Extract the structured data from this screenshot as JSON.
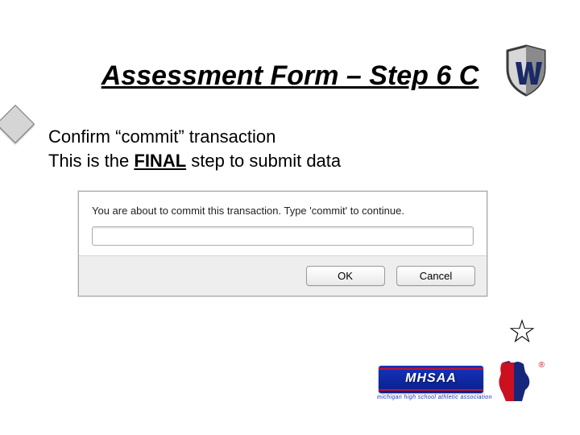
{
  "heading": "Assessment Form – Step 6 C",
  "body": {
    "line1": "Confirm “commit” transaction",
    "line2_pre": "This is the ",
    "line2_emph": "FINAL",
    "line2_post": " step to submit data"
  },
  "dialog": {
    "message": "You are about to commit this transaction.  Type 'commit' to continue.",
    "input_value": "",
    "ok_label": "OK",
    "cancel_label": "Cancel"
  },
  "logo": {
    "mhsaa_text": "MHSAA",
    "mhsaa_tagline": "michigan high school athletic association",
    "reg": "®"
  },
  "star_glyph": "☆"
}
